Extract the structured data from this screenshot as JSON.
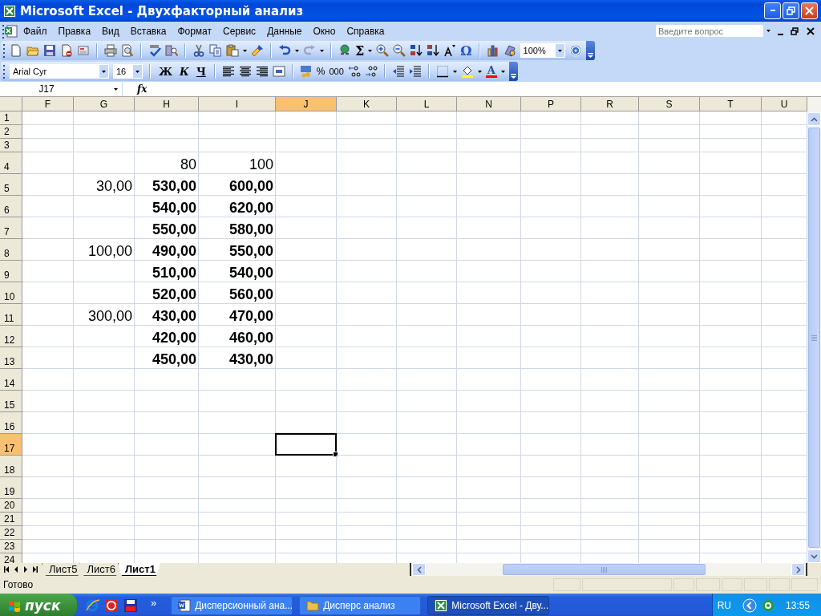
{
  "window": {
    "title": "Microsoft Excel - Двухфакторный анализ"
  },
  "menu": {
    "items": [
      "Файл",
      "Правка",
      "Вид",
      "Вставка",
      "Формат",
      "Сервис",
      "Данные",
      "Окно",
      "Справка"
    ],
    "help_search": {
      "placeholder": "Введите вопрос"
    }
  },
  "standard_toolbar": {
    "sum_label": "Σ",
    "special_char_label": "Ω",
    "zoom": "100%"
  },
  "formatting_toolbar": {
    "font": "Arial Cyr",
    "size": "16",
    "bold_label": "Ж",
    "italic_label": "К",
    "underline_label": "Ч",
    "percent_label": "%",
    "thousands_label": "000",
    "font_color_label": "A"
  },
  "formula_bar": {
    "name_box": "J17",
    "fx_label": "fx"
  },
  "sheet": {
    "columns": [
      {
        "label": "F",
        "selected": false
      },
      {
        "label": "G",
        "selected": false
      },
      {
        "label": "H",
        "selected": false
      },
      {
        "label": "I",
        "selected": false
      },
      {
        "label": "J",
        "selected": true
      },
      {
        "label": "K",
        "selected": false
      },
      {
        "label": "L",
        "selected": false
      },
      {
        "label": "N",
        "selected": false
      },
      {
        "label": "P",
        "selected": false
      },
      {
        "label": "R",
        "selected": false
      },
      {
        "label": "S",
        "selected": false
      },
      {
        "label": "T",
        "selected": false
      },
      {
        "label": "U",
        "selected": false
      }
    ],
    "rows": [
      {
        "label": "1",
        "selected": false,
        "cells": []
      },
      {
        "label": "2",
        "selected": false,
        "cells": []
      },
      {
        "label": "3",
        "selected": false,
        "cells": []
      },
      {
        "label": "4",
        "selected": false,
        "cells": [
          null,
          null,
          {
            "text": "80",
            "bold": false
          },
          {
            "text": "100",
            "bold": false
          }
        ]
      },
      {
        "label": "5",
        "selected": false,
        "cells": [
          null,
          {
            "text": "30,00",
            "bold": false
          },
          {
            "text": "530,00",
            "bold": true
          },
          {
            "text": "600,00",
            "bold": true
          }
        ]
      },
      {
        "label": "6",
        "selected": false,
        "cells": [
          null,
          null,
          {
            "text": "540,00",
            "bold": true
          },
          {
            "text": "620,00",
            "bold": true
          }
        ]
      },
      {
        "label": "7",
        "selected": false,
        "cells": [
          null,
          null,
          {
            "text": "550,00",
            "bold": true
          },
          {
            "text": "580,00",
            "bold": true
          }
        ]
      },
      {
        "label": "8",
        "selected": false,
        "cells": [
          null,
          {
            "text": "100,00",
            "bold": false
          },
          {
            "text": "490,00",
            "bold": true
          },
          {
            "text": "550,00",
            "bold": true
          }
        ]
      },
      {
        "label": "9",
        "selected": false,
        "cells": [
          null,
          null,
          {
            "text": "510,00",
            "bold": true
          },
          {
            "text": "540,00",
            "bold": true
          }
        ]
      },
      {
        "label": "10",
        "selected": false,
        "cells": [
          null,
          null,
          {
            "text": "520,00",
            "bold": true
          },
          {
            "text": "560,00",
            "bold": true
          }
        ]
      },
      {
        "label": "11",
        "selected": false,
        "cells": [
          null,
          {
            "text": "300,00",
            "bold": false
          },
          {
            "text": "430,00",
            "bold": true
          },
          {
            "text": "470,00",
            "bold": true
          }
        ]
      },
      {
        "label": "12",
        "selected": false,
        "cells": [
          null,
          null,
          {
            "text": "420,00",
            "bold": true
          },
          {
            "text": "460,00",
            "bold": true
          }
        ]
      },
      {
        "label": "13",
        "selected": false,
        "cells": [
          null,
          null,
          {
            "text": "450,00",
            "bold": true
          },
          {
            "text": "430,00",
            "bold": true
          }
        ]
      },
      {
        "label": "14",
        "selected": false,
        "cells": []
      },
      {
        "label": "15",
        "selected": false,
        "cells": []
      },
      {
        "label": "16",
        "selected": false,
        "cells": []
      },
      {
        "label": "17",
        "selected": true,
        "cells": []
      },
      {
        "label": "18",
        "selected": false,
        "cells": []
      },
      {
        "label": "19",
        "selected": false,
        "cells": []
      },
      {
        "label": "20",
        "selected": false,
        "cells": []
      },
      {
        "label": "21",
        "selected": false,
        "cells": []
      },
      {
        "label": "22",
        "selected": false,
        "cells": []
      },
      {
        "label": "23",
        "selected": false,
        "cells": []
      },
      {
        "label": "24",
        "selected": false,
        "cells": []
      }
    ]
  },
  "sheet_tabs": [
    {
      "label": "Лист5",
      "selected": false
    },
    {
      "label": "Лист6",
      "selected": false
    },
    {
      "label": "Лист1",
      "selected": true
    }
  ],
  "status_bar": {
    "text": "Готово"
  },
  "taskbar": {
    "start": "пуск",
    "more": "»",
    "tasks": [
      {
        "label": "Дисперсионный ана...",
        "kind": "word",
        "selected": false
      },
      {
        "label": "Дисперс анализ",
        "kind": "folder",
        "selected": false
      },
      {
        "label": "Microsoft Excel - Дву...",
        "kind": "excel",
        "selected": true
      }
    ],
    "language": "RU",
    "clock": "13:55"
  }
}
